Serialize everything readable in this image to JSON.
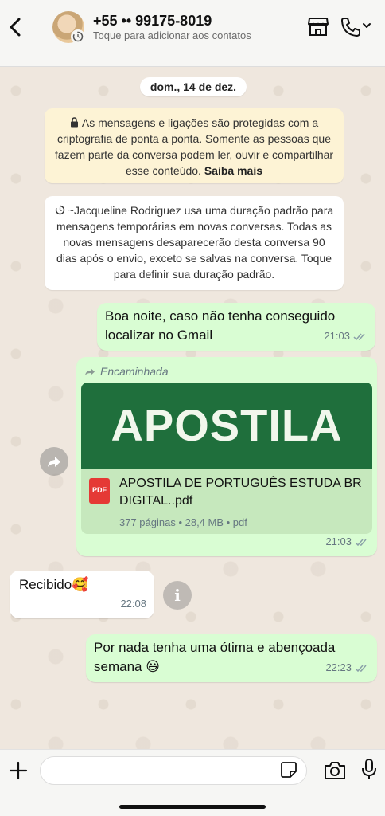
{
  "header": {
    "contact_name": "+55 •• 99175-8019",
    "contact_subtitle": "Toque para adicionar aos contatos"
  },
  "chat": {
    "date_label": "dom., 14 de dez.",
    "encryption_notice": "As mensagens e ligações são protegidas com a criptografia de ponta a ponta. Somente as pessoas que fazem parte da conversa podem ler, ouvir e compartilhar esse conteúdo.",
    "encryption_link": "Saiba mais",
    "timer_notice": "~Jacqueline Rodriguez usa uma duração padrão para mensagens temporárias em novas conversas. Todas as novas mensagens desaparecerão desta conversa 90 dias após o envio, exceto se salvas na conversa. Toque para definir sua duração padrão.",
    "messages": [
      {
        "text": "Boa noite, caso não tenha conseguido localizar no Gmail",
        "time": "21:03"
      },
      {
        "forwarded_label": "Encaminhada",
        "preview_title": "APOSTILA",
        "file_badge": "PDF",
        "file_name": "APOSTILA DE PORTUGUÊS ESTUDA BR DIGITAL..pdf",
        "file_meta": "377 páginas • 28,4 MB • pdf",
        "time": "21:03"
      },
      {
        "text": "Recibido🥰",
        "time": "22:08"
      },
      {
        "text": "Por nada tenha uma ótima e abençoada semana 😃",
        "time": "22:23"
      }
    ]
  },
  "composer": {
    "placeholder": ""
  },
  "colors": {
    "outgoing_bubble": "#d9fdd3",
    "incoming_bubble": "#ffffff",
    "encryption_bg": "#fdf3d5",
    "read_ticks": "#53bdeb",
    "preview_green": "#1f6f3c"
  }
}
